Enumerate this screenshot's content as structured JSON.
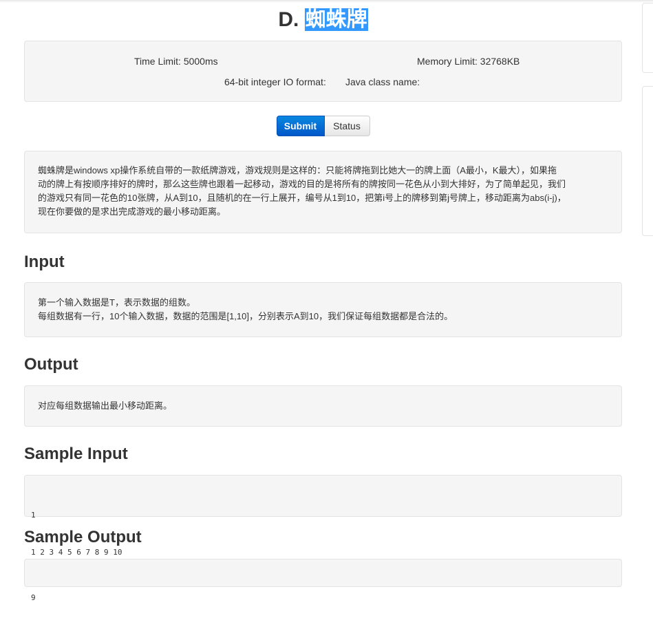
{
  "problem": {
    "title_prefix": "D.",
    "title_highlight": "蜘蛛牌"
  },
  "limits": {
    "time_limit": "Time Limit: 5000ms",
    "memory_limit": "Memory Limit: 32768KB",
    "io_format": "64-bit integer IO format:",
    "java_class": "Java class name:"
  },
  "buttons": {
    "submit": "Submit",
    "status": "Status"
  },
  "description": {
    "lines": [
      "蜘蛛牌是windows xp操作系统自带的一款纸牌游戏，游戏规则是这样的：只能将牌拖到比她大一的牌上面（A最小，K最大），如果拖",
      "动的牌上有按顺序排好的牌时，那么这些牌也跟着一起移动，游戏的目的是将所有的牌按同一花色从小到大排好，为了简单起见，我们",
      "的游戏只有同一花色的10张牌，从A到10，且随机的在一行上展开，编号从1到10，把第i号上的牌移到第j号牌上，移动距离为abs(i-j)，",
      "现在你要做的是求出完成游戏的最小移动距离。"
    ]
  },
  "sections": {
    "input_heading": "Input",
    "input_lines": [
      "第一个输入数据是T，表示数据的组数。",
      "每组数据有一行，10个输入数据，数据的范围是[1,10]，分别表示A到10，我们保证每组数据都是合法的。"
    ],
    "output_heading": "Output",
    "output_text": "对应每组数据输出最小移动距离。",
    "sample_input_heading": "Sample Input",
    "sample_input_lines": [
      "1",
      "1 2 3 4 5 6 7 8 9 10"
    ],
    "sample_output_heading": "Sample Output",
    "sample_output_lines": [
      "9"
    ]
  }
}
